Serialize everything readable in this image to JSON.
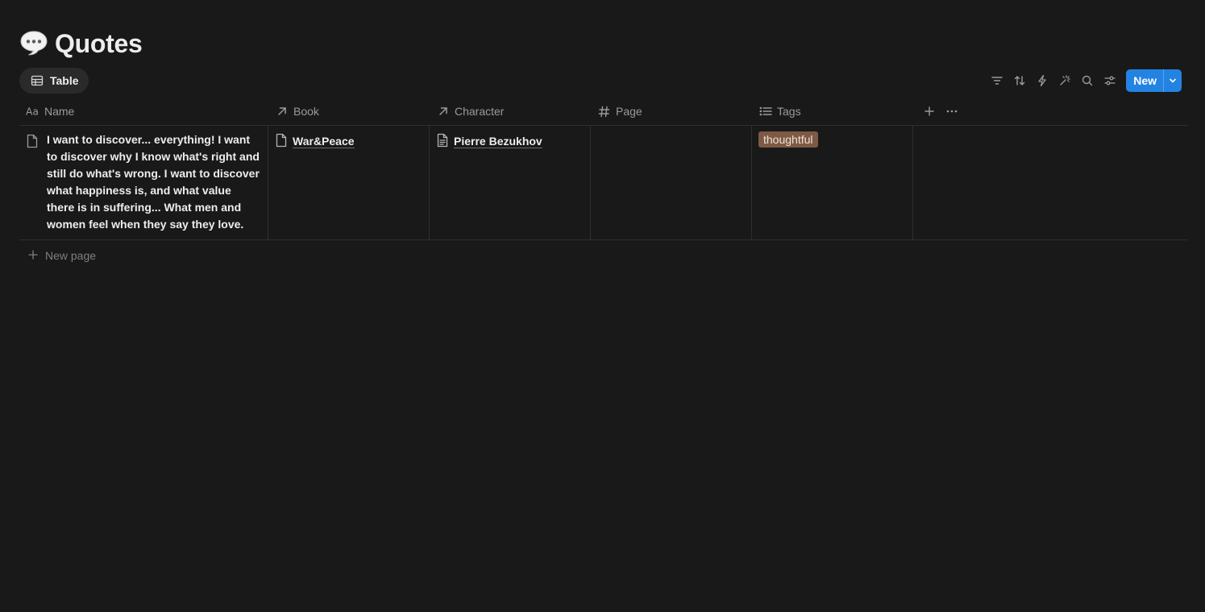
{
  "page": {
    "emoji_icon": "speech-balloon-icon",
    "title": "Quotes"
  },
  "view": {
    "tab_label": "Table",
    "icon": "table-icon"
  },
  "toolbar": {
    "icons": [
      "filter-icon",
      "sort-icon",
      "automation-icon",
      "ai-sparkle-icon",
      "search-icon",
      "settings-icon"
    ],
    "new_label": "New"
  },
  "table": {
    "columns": [
      {
        "label": "Name",
        "icon": "text-aa-icon"
      },
      {
        "label": "Book",
        "icon": "relation-arrow-icon"
      },
      {
        "label": "Character",
        "icon": "relation-arrow-icon"
      },
      {
        "label": "Page",
        "icon": "number-hash-icon"
      },
      {
        "label": "Tags",
        "icon": "list-icon"
      }
    ],
    "rows": [
      {
        "name": "I want to discover... everything! I want to discover why I know what's right and still do what's wrong. I want to discover what happiness is, and what value there is in suffering... What men and women feel when they say they love.",
        "book": "War&Peace",
        "character": "Pierre Bezukhov",
        "page": "",
        "tags": [
          "thoughtful"
        ]
      }
    ],
    "new_page_label": "New page"
  },
  "colors": {
    "background": "#191919",
    "accent_blue": "#2383e2",
    "tag_brown": "#7d5a44",
    "grid_line": "#2f2f2f"
  }
}
